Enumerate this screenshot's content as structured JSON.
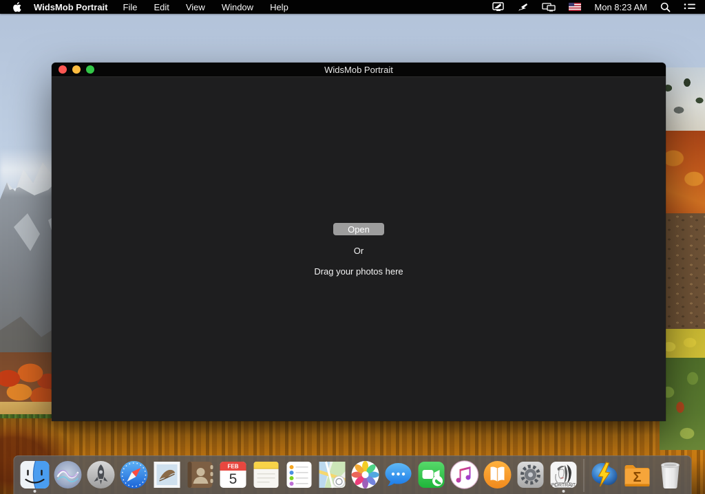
{
  "menu_bar": {
    "app_name": "WidsMob Portrait",
    "menus": [
      "File",
      "Edit",
      "View",
      "Window",
      "Help"
    ],
    "clock": "Mon 8:23 AM",
    "status_icons": [
      "display-flag-icon",
      "pointer-icon",
      "dual-displays-icon",
      "us-flag-icon",
      "spotlight-icon",
      "notification-center-icon"
    ]
  },
  "window": {
    "title": "WidsMob Portrait",
    "open_button_label": "Open",
    "or_label": "Or",
    "drag_label": "Drag your photos here"
  },
  "dock": {
    "items": [
      "finder",
      "siri",
      "launchpad",
      "safari",
      "mail",
      "contacts",
      "calendar",
      "notes",
      "reminders",
      "maps",
      "photos",
      "messages",
      "facetime",
      "itunes",
      "books",
      "system-preferences",
      "widsmob-portrait",
      "separator",
      "lightning-app",
      "sigma-folder",
      "trash"
    ],
    "running": [
      "finder",
      "widsmob-portrait"
    ],
    "calendar": {
      "month": "FEB",
      "day": "5"
    },
    "portrait_badge": "PORTRAIT"
  },
  "colors": {
    "menubar_bg": "#020202",
    "window_bg": "#1e1e1f",
    "titlebar_bg": "#060606",
    "open_button_bg": "#9d9d9d",
    "dock_bg": "rgba(92,89,86,0.88)",
    "traffic_red": "#fc5753",
    "traffic_yellow": "#fdbc40",
    "traffic_green": "#33c748"
  }
}
